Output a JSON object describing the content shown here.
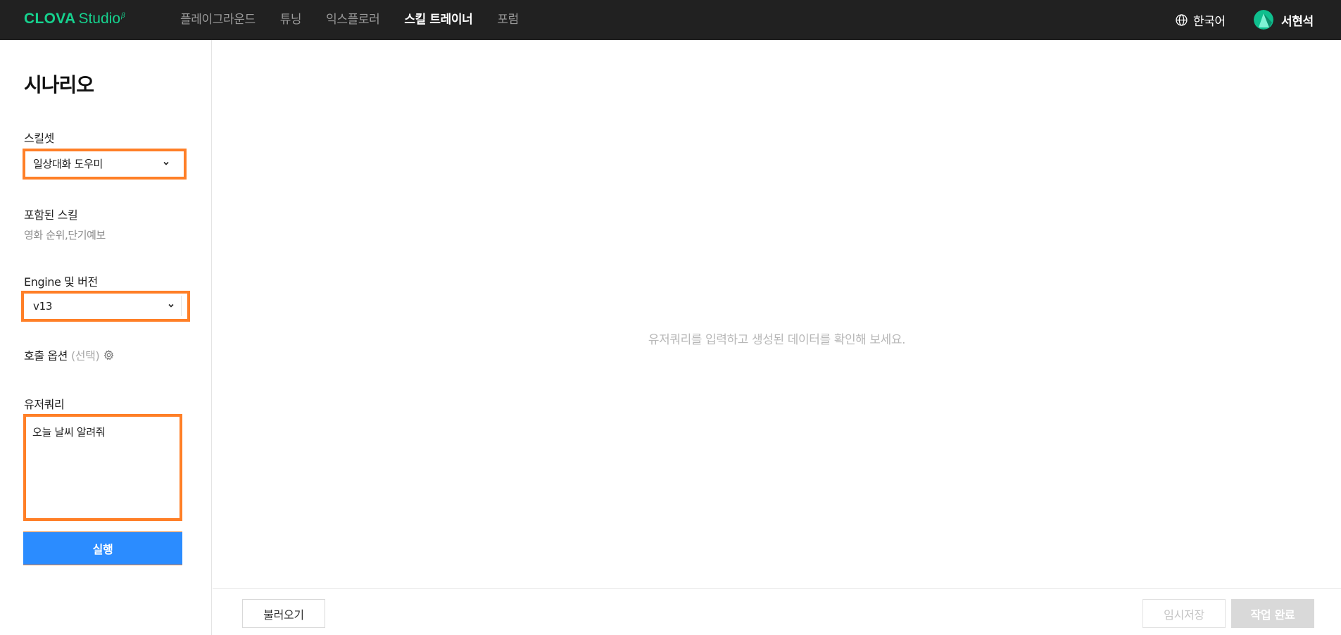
{
  "brand": {
    "name": "CLOVA",
    "product": "Studio",
    "badge": "β"
  },
  "nav": [
    {
      "label": "플레이그라운드",
      "active": false
    },
    {
      "label": "튜닝",
      "active": false
    },
    {
      "label": "익스플로러",
      "active": false
    },
    {
      "label": "스킬 트레이너",
      "active": true
    },
    {
      "label": "포럼",
      "active": false
    }
  ],
  "header": {
    "language": "한국어",
    "user_name": "서현석"
  },
  "sidebar": {
    "title": "시나리오",
    "skillset": {
      "label": "스킬셋",
      "value": "일상대화 도우미"
    },
    "included_skills": {
      "label": "포함된 스킬",
      "value": "영화 순위,단기예보"
    },
    "engine": {
      "label": "Engine 및 버전",
      "value": "v13"
    },
    "call_options": {
      "label": "호출 옵션",
      "hint": "(선택)"
    },
    "user_query": {
      "label": "유저쿼리",
      "value": "오늘 날씨 알려줘"
    },
    "run_label": "실행"
  },
  "main": {
    "empty_message": "유저쿼리를 입력하고 생성된 데이터를 확인해 보세요."
  },
  "footer": {
    "load_label": "불러오기",
    "temp_save_label": "임시저장",
    "complete_label": "작업 완료"
  },
  "colors": {
    "accent": "#2b8cff",
    "brand": "#16d18e",
    "highlight": "#ff7f27",
    "topbar": "#212121"
  }
}
